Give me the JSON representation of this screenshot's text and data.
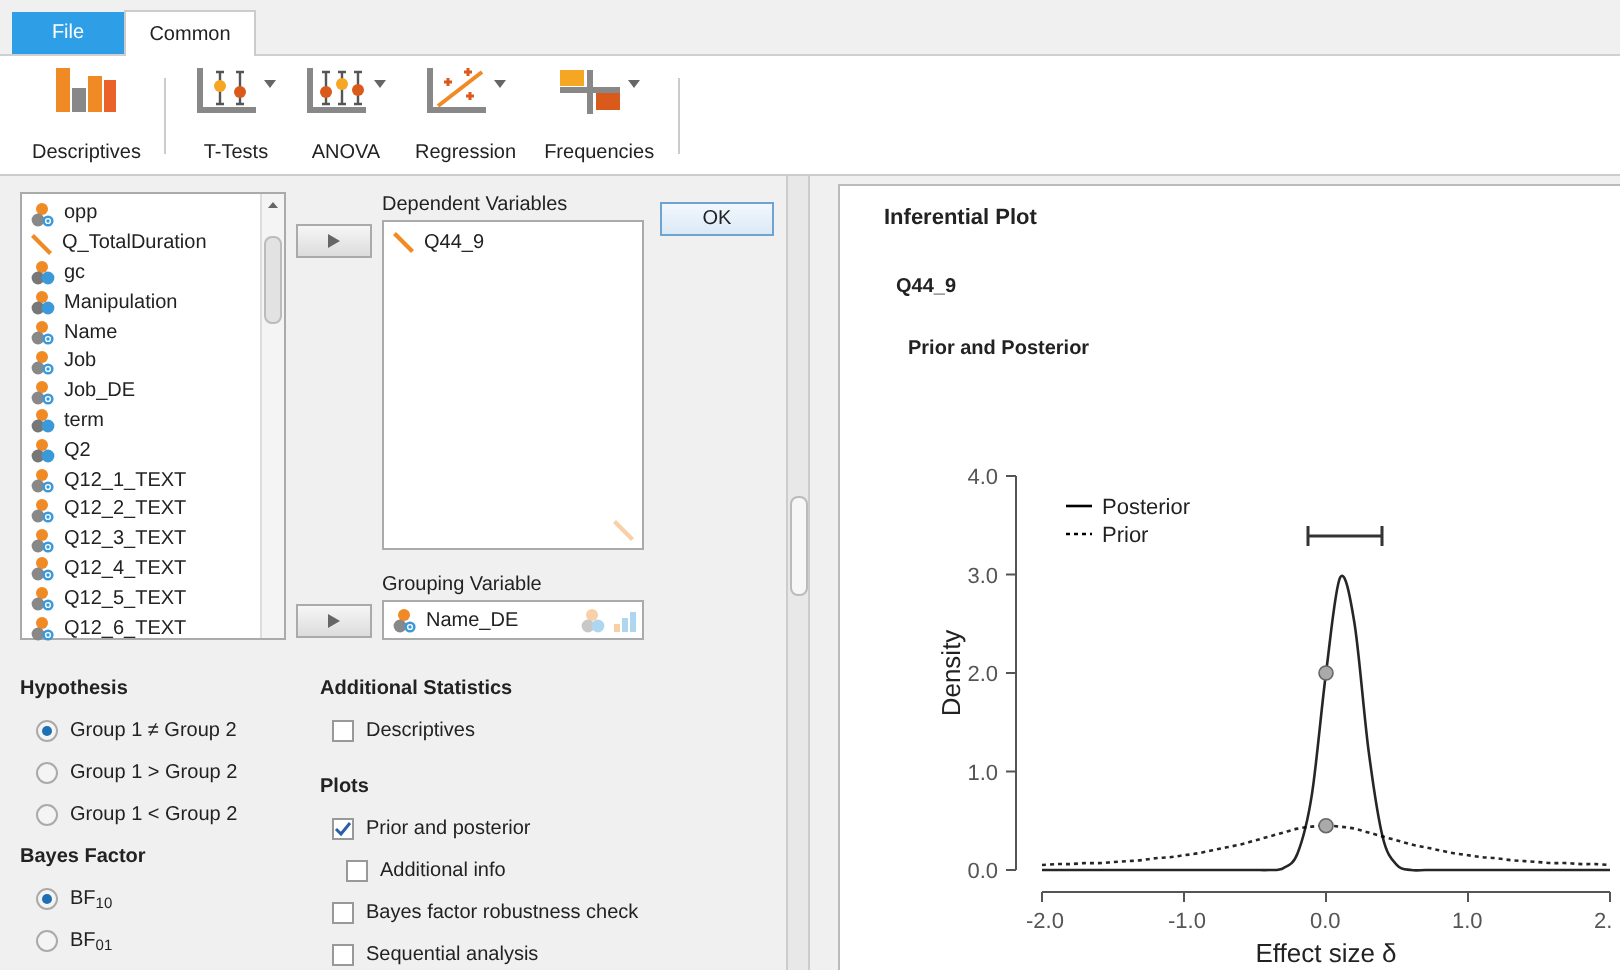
{
  "tabs": [
    {
      "label": "File",
      "selected": false,
      "kind": "file"
    },
    {
      "label": "Common",
      "selected": true,
      "kind": "tab"
    }
  ],
  "ribbon": [
    {
      "label": "Descriptives",
      "kind": "descriptives",
      "dropdown": false
    },
    {
      "label": "T-Tests",
      "kind": "ttests",
      "dropdown": true
    },
    {
      "label": "ANOVA",
      "kind": "anova",
      "dropdown": true
    },
    {
      "label": "Regression",
      "kind": "regression",
      "dropdown": true
    },
    {
      "label": "Frequencies",
      "kind": "frequencies",
      "dropdown": true
    }
  ],
  "variables": [
    {
      "name": "opp",
      "kind": "nominal_text"
    },
    {
      "name": "Q_TotalDuration",
      "kind": "scale"
    },
    {
      "name": "gc",
      "kind": "nominal"
    },
    {
      "name": "Manipulation",
      "kind": "nominal"
    },
    {
      "name": "Name",
      "kind": "nominal_text"
    },
    {
      "name": "Job",
      "kind": "nominal_text"
    },
    {
      "name": "Job_DE",
      "kind": "nominal_text"
    },
    {
      "name": "term",
      "kind": "nominal"
    },
    {
      "name": "Q2",
      "kind": "nominal"
    },
    {
      "name": "Q12_1_TEXT",
      "kind": "nominal_text"
    },
    {
      "name": "Q12_2_TEXT",
      "kind": "nominal_text"
    },
    {
      "name": "Q12_3_TEXT",
      "kind": "nominal_text"
    },
    {
      "name": "Q12_4_TEXT",
      "kind": "nominal_text"
    },
    {
      "name": "Q12_5_TEXT",
      "kind": "nominal_text"
    },
    {
      "name": "Q12_6_TEXT",
      "kind": "nominal_text"
    }
  ],
  "dependent": {
    "label": "Dependent Variables",
    "items": [
      {
        "name": "Q44_9",
        "kind": "scale"
      }
    ]
  },
  "grouping": {
    "label": "Grouping Variable",
    "items": [
      {
        "name": "Name_DE",
        "kind": "nominal_text"
      }
    ]
  },
  "ok_button": "OK",
  "hypothesis": {
    "title": "Hypothesis",
    "options": [
      {
        "label": "Group 1 ≠ Group 2",
        "selected": true
      },
      {
        "label": "Group 1 > Group 2",
        "selected": false
      },
      {
        "label": "Group 1 < Group 2",
        "selected": false
      }
    ]
  },
  "bayes_factor": {
    "title": "Bayes Factor",
    "options": [
      {
        "label": "BF$_{10}$",
        "selected": true
      },
      {
        "label": "BF$_{01}$",
        "selected": false
      }
    ]
  },
  "additional_statistics": {
    "title": "Additional Statistics",
    "options": [
      {
        "label": "Descriptives",
        "checked": false
      }
    ]
  },
  "plots": {
    "title": "Plots",
    "options": [
      {
        "label": "Prior and posterior",
        "checked": true,
        "children": [
          {
            "label": "Additional info",
            "checked": false
          }
        ]
      },
      {
        "label": "Bayes factor robustness check",
        "checked": false
      },
      {
        "label": "Sequential analysis",
        "checked": false
      }
    ]
  },
  "output": {
    "title": "Inferential Plot",
    "variable": "Q44_9",
    "subtitle": "Prior and Posterior",
    "chart_data": {
      "type": "line",
      "xlabel": "Effect size δ",
      "ylabel": "Density",
      "x": [
        -2.0,
        -1.9,
        -1.8,
        -1.7,
        -1.6,
        -1.5,
        -1.4,
        -1.3,
        -1.2,
        -1.1,
        -1.0,
        -0.9,
        -0.8,
        -0.7,
        -0.6,
        -0.5,
        -0.4,
        -0.3,
        -0.2,
        -0.1,
        0.0,
        0.1,
        0.2,
        0.3,
        0.4,
        0.5,
        0.6,
        0.7,
        0.8,
        0.9,
        1.0,
        1.1,
        1.2,
        1.3,
        1.4,
        1.5,
        1.6,
        1.7,
        1.8,
        1.9,
        2.0
      ],
      "series": [
        {
          "name": "Posterior",
          "color": "#000000",
          "line_style": "solid",
          "values": [
            0,
            0,
            0,
            0,
            0,
            0,
            0,
            0,
            0,
            0,
            0,
            0,
            0,
            0,
            0,
            0,
            0,
            0.02,
            0.17,
            0.76,
            2.0,
            2.97,
            2.51,
            1.21,
            0.33,
            0.05,
            0,
            0,
            0,
            0,
            0,
            0,
            0,
            0,
            0,
            0,
            0,
            0,
            0,
            0,
            0
          ]
        },
        {
          "name": "Prior",
          "color": "#000000",
          "line_style": "dashed",
          "values": [
            0.05,
            0.06,
            0.06,
            0.07,
            0.07,
            0.08,
            0.09,
            0.1,
            0.12,
            0.13,
            0.15,
            0.17,
            0.2,
            0.23,
            0.26,
            0.3,
            0.34,
            0.38,
            0.42,
            0.44,
            0.45,
            0.44,
            0.42,
            0.38,
            0.34,
            0.3,
            0.26,
            0.23,
            0.2,
            0.17,
            0.15,
            0.13,
            0.12,
            0.1,
            0.09,
            0.08,
            0.07,
            0.07,
            0.06,
            0.06,
            0.05
          ]
        }
      ],
      "legend": true,
      "xlim": [
        -2,
        2
      ],
      "ylim": [
        0,
        4
      ],
      "xticks": [
        {
          "value": -2,
          "label": "-2.0"
        },
        {
          "value": -1,
          "label": "-1.0"
        },
        {
          "value": 0,
          "label": "0.0"
        },
        {
          "value": 1,
          "label": "1.0"
        },
        {
          "value": 2,
          "label": "2."
        }
      ],
      "yticks": [
        {
          "value": 0,
          "label": "0.0"
        },
        {
          "value": 1,
          "label": "1.0"
        },
        {
          "value": 2,
          "label": "2.0"
        },
        {
          "value": 3,
          "label": "3.0"
        },
        {
          "value": 4,
          "label": "4.0"
        }
      ]
    }
  }
}
